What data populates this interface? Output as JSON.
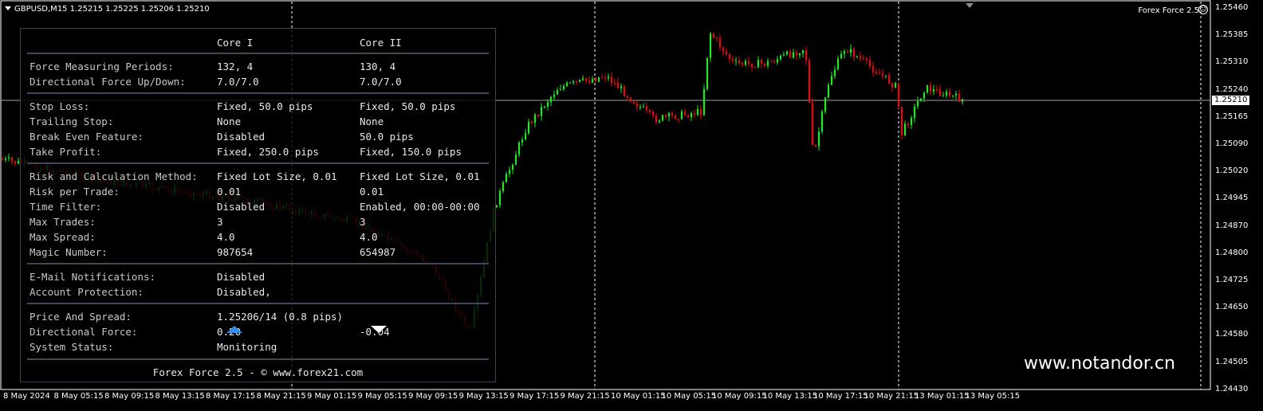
{
  "header": {
    "symbol_line": "GBPUSD,M15  1.25215 1.25225 1.25206 1.25210",
    "ea_name": "Forex Force 2.5"
  },
  "colors": {
    "bull": "#00ff00",
    "bear": "#ff0000",
    "grid": "#ffffff",
    "panel_border": "#3a4250",
    "up_arrow": "#2e8ef0"
  },
  "panel": {
    "col_headers": [
      "Core I",
      "Core II"
    ],
    "groups": [
      [
        {
          "label": "Force Measuring Periods:",
          "core1": "132, 4",
          "core2": "130, 4"
        },
        {
          "label": "Directional Force Up/Down:",
          "core1": "7.0/7.0",
          "core2": "7.0/7.0"
        }
      ],
      [
        {
          "label": "Stop Loss:",
          "core1": "Fixed, 50.0 pips",
          "core2": "Fixed, 50.0 pips"
        },
        {
          "label": "Trailing Stop:",
          "core1": "None",
          "core2": "None"
        },
        {
          "label": "Break Even Feature:",
          "core1": "Disabled",
          "core2": "50.0 pips"
        },
        {
          "label": "Take Profit:",
          "core1": "Fixed, 250.0 pips",
          "core2": "Fixed, 150.0 pips"
        }
      ],
      [
        {
          "label": "Risk and Calculation Method:",
          "core1": "Fixed Lot Size, 0.01",
          "core2": "Fixed Lot Size, 0.01"
        },
        {
          "label": "Risk per Trade:",
          "core1": "0.01",
          "core2": "0.01"
        },
        {
          "label": "Time Filter:",
          "core1": "Disabled",
          "core2": "Enabled, 00:00-00:00"
        },
        {
          "label": "Max Trades:",
          "core1": "3",
          "core2": "3"
        },
        {
          "label": "Max Spread:",
          "core1": "4.0",
          "core2": "4.0"
        },
        {
          "label": "Magic Number:",
          "core1": "987654",
          "core2": "654987"
        }
      ],
      [
        {
          "label": "E-Mail Notifications:",
          "core1": "Disabled",
          "core2": ""
        },
        {
          "label": "Account Protection:",
          "core1": "Disabled,",
          "core2": ""
        }
      ],
      [
        {
          "label": "Price And Spread:",
          "core1": "1.25206/14 (0.8 pips)",
          "core2": ""
        },
        {
          "label": "Directional Force:",
          "core1": "0.20",
          "core2": "-0.04",
          "icon1": "arrow-up-icon",
          "icon2": "arrow-down-icon"
        },
        {
          "label": "System Status:",
          "core1": "Monitoring",
          "core2": ""
        }
      ]
    ],
    "footer": "Forex Force 2.5 - © www.forex21.com"
  },
  "watermark": "www.notandor.cn",
  "price_axis": {
    "labels": [
      "1.25460",
      "1.25385",
      "1.25310",
      "1.25240",
      "1.25165",
      "1.25090",
      "1.25020",
      "1.24945",
      "1.24870",
      "1.24800",
      "1.24725",
      "1.24650",
      "1.24580",
      "1.24505",
      "1.24430"
    ],
    "current": "1.25210"
  },
  "time_axis": [
    "8 May 2024",
    "8 May 05:15",
    "8 May 09:15",
    "8 May 13:15",
    "8 May 17:15",
    "8 May 21:15",
    "9 May 01:15",
    "9 May 05:15",
    "9 May 09:15",
    "9 May 13:15",
    "9 May 17:15",
    "9 May 21:15",
    "10 May 01:15",
    "10 May 05:15",
    "10 May 09:15",
    "10 May 13:15",
    "10 May 17:15",
    "10 May 21:15",
    "13 May 01:15",
    "13 May 05:15"
  ]
}
